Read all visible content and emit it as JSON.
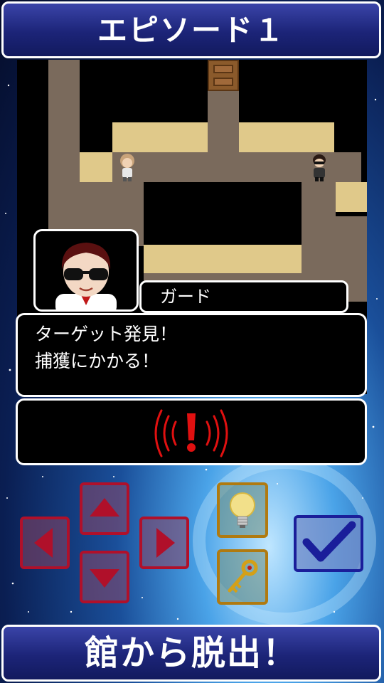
{
  "header": {
    "title": "エピソード１"
  },
  "footer": {
    "title": "館から脱出！"
  },
  "dialog": {
    "speaker": "ガード",
    "lines": [
      "ターゲット発見！",
      "捕獲にかかる！"
    ]
  },
  "status": {
    "alert_icon": "exclamation-alert-icon"
  },
  "controls": {
    "dpad": [
      "up",
      "down",
      "left",
      "right"
    ],
    "items": [
      "lightbulb-hint",
      "key"
    ],
    "confirm": "checkmark"
  },
  "colors": {
    "banner": "#1c2478",
    "floor": "#7a6a5c",
    "wall": "#e0c98a",
    "alert": "#e01010",
    "dpad_border": "#b0102a",
    "item_border": "#b07a10",
    "confirm_border": "#1a1e9a"
  }
}
